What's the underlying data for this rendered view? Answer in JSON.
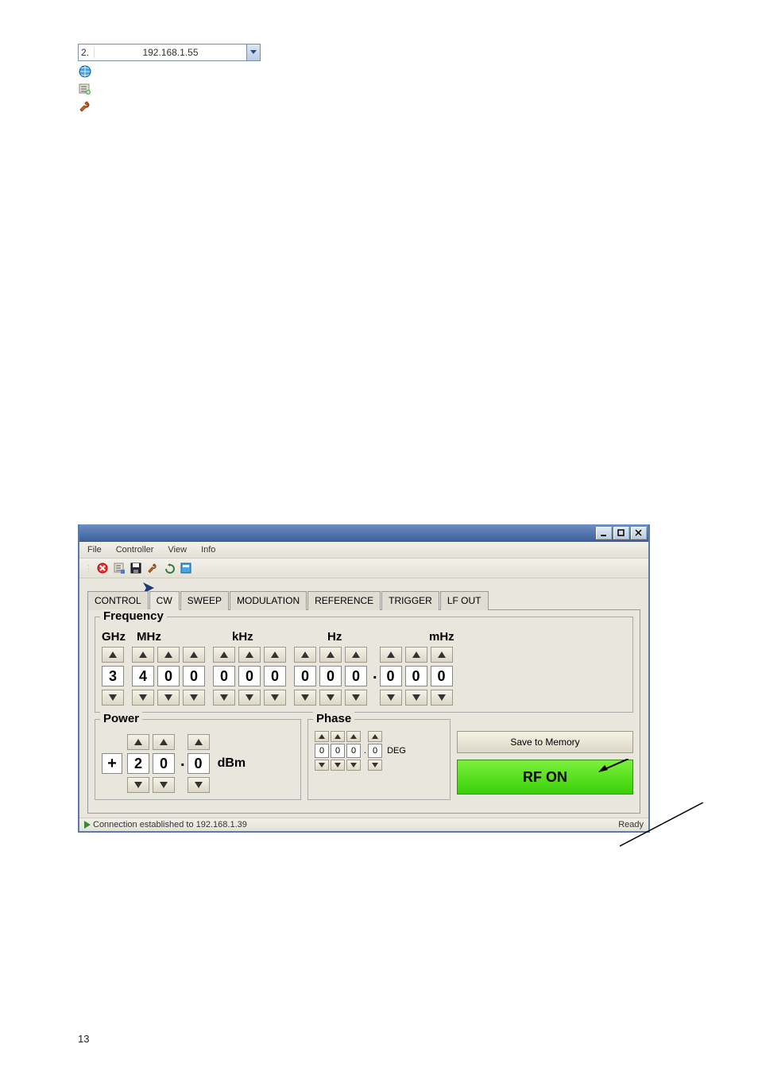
{
  "top_widget": {
    "label": "2.",
    "ip": "192.168.1.55"
  },
  "menu": {
    "file": "File",
    "controller": "Controller",
    "view": "View",
    "info": "Info"
  },
  "tabs": {
    "control": "CONTROL",
    "cw": "CW",
    "sweep": "SWEEP",
    "modulation": "MODULATION",
    "reference": "REFERENCE",
    "trigger": "TRIGGER",
    "lfout": "LF OUT"
  },
  "frequency": {
    "title": "Frequency",
    "labels": {
      "ghz": "GHz",
      "mhz": "MHz",
      "khz": "kHz",
      "hz": "Hz",
      "mhz_low": "mHz"
    },
    "digits": [
      "3",
      "4",
      "0",
      "0",
      "0",
      "0",
      "0",
      "0",
      "0",
      "0",
      "0",
      "0",
      "0"
    ]
  },
  "power": {
    "title": "Power",
    "sign": "+",
    "digits": [
      "2",
      "0",
      "0"
    ],
    "unit": "dBm"
  },
  "phase": {
    "title": "Phase",
    "digits": [
      "0",
      "0",
      "0",
      "0"
    ],
    "unit": "DEG"
  },
  "buttons": {
    "save": "Save to Memory",
    "rf": "RF ON"
  },
  "status": {
    "connection": "Connection established to 192.168.1.39",
    "ready": "Ready"
  },
  "page_number": "13"
}
